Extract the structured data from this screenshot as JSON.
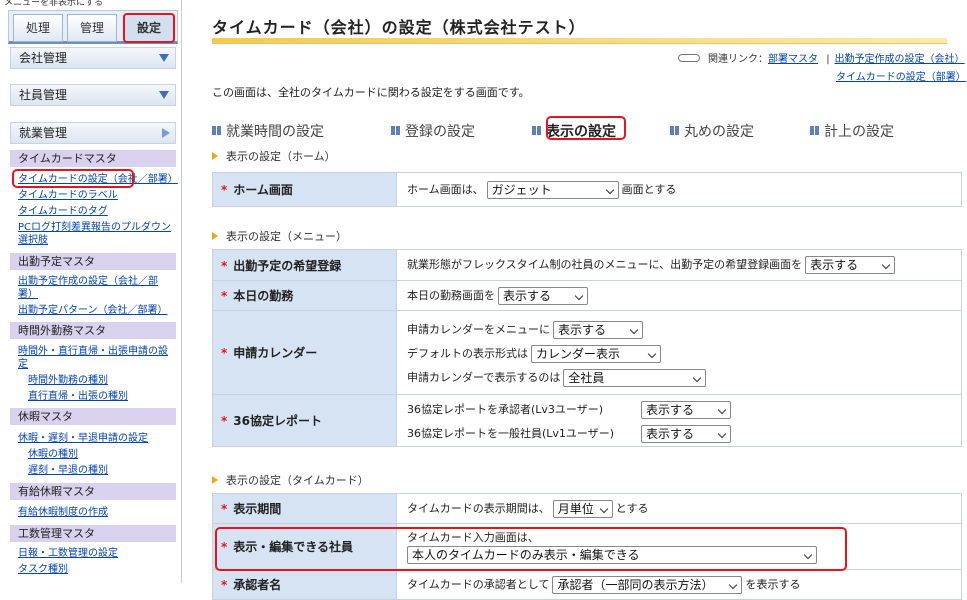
{
  "topbar": {
    "text": "メニューを非表示にする"
  },
  "tabs": [
    {
      "label": "処理"
    },
    {
      "label": "管理"
    },
    {
      "label": "設定"
    }
  ],
  "accordions": {
    "company": "会社管理",
    "employee": "社員管理",
    "work": "就業管理"
  },
  "menu": {
    "cat1": "タイムカードマスタ",
    "c1": [
      "タイムカードの設定（会社／部署）",
      "タイムカードのラベル",
      "タイムカードのタグ",
      "PCログ打刻差異報告のプルダウン",
      "選択肢"
    ],
    "cat2": "出勤予定マスタ",
    "c2": [
      "出勤予定作成の設定（会社／部",
      "署）",
      "出勤予定パターン（会社／部署）"
    ],
    "cat3": "時間外勤務マスタ",
    "c3": [
      "時間外・直行直帰・出張申請の設",
      "定",
      "時間外勤務の種別",
      "直行直帰・出張の種別"
    ],
    "cat4": "休暇マスタ",
    "c4": [
      "休暇・遅刻・早退申請の設定",
      "休暇の種別",
      "遅刻・早退の種別"
    ],
    "cat5": "有給休暇マスタ",
    "c5": [
      "有給休暇制度の作成"
    ],
    "cat6": "工数管理マスタ",
    "c6": [
      "日報・工数管理の設定",
      "タスク種別"
    ]
  },
  "page": {
    "title": "タイムカード（会社）の設定（株式会社テスト）",
    "related_prefix": "関連リンク：",
    "related": [
      "部署マスタ",
      "出勤予定作成の設定（会社）",
      "タイムカードの設定（部署）"
    ],
    "related_sep": "|",
    "intro": "この画面は、全社のタイムカードに関わる設定をする画面です。"
  },
  "nav": [
    "就業時間の設定",
    "登録の設定",
    "表示の設定",
    "丸めの設定",
    "計上の設定"
  ],
  "sections": {
    "home": "表示の設定（ホーム）",
    "menu": "表示の設定（メニュー）",
    "timecard": "表示の設定（タイムカード）"
  },
  "rows": {
    "home": {
      "label": "ホーム画面",
      "pre": "ホーム画面は、",
      "select": "ガジェット",
      "post": "画面とする"
    },
    "plan": {
      "label": "出勤予定の希望登録",
      "pre": "就業形態がフレックスタイム制の社員のメニューに、出勤予定の希望登録画面を",
      "select": "表示する"
    },
    "today": {
      "label": "本日の勤務",
      "pre": "本日の勤務画面を",
      "select": "表示する"
    },
    "cal": {
      "label": "申請カレンダー",
      "l1": "申請カレンダーをメニューに",
      "s1": "表示する",
      "l2": "デフォルトの表示形式は",
      "s2": "カレンダー表示",
      "l3": "申請カレンダーで表示するのは",
      "s3": "全社員"
    },
    "r36": {
      "label": "36協定レポート",
      "l1": "36協定レポートを承認者(Lv3ユーザー)",
      "s1": "表示する",
      "l2": "36協定レポートを一般社員(Lv1ユーザー)",
      "s2": "表示する"
    },
    "period": {
      "label": "表示期間",
      "pre": "タイムカードの表示期間は、",
      "select": "月単位",
      "post": "とする"
    },
    "edit": {
      "label": "表示・編集できる社員",
      "l1": "タイムカード入力画面は、",
      "select": "本人のタイムカードのみ表示・編集できる"
    },
    "approver": {
      "label": "承認者名",
      "pre": "タイムカードの承認者として",
      "select": "承認者（一部同の表示方法）",
      "post": "を表示する"
    }
  },
  "colors": {
    "accent_red": "#e2161d",
    "header_blue": "#d6e3f2",
    "category_purple": "#d9d2ef",
    "title_bar": "#f5c94d"
  }
}
